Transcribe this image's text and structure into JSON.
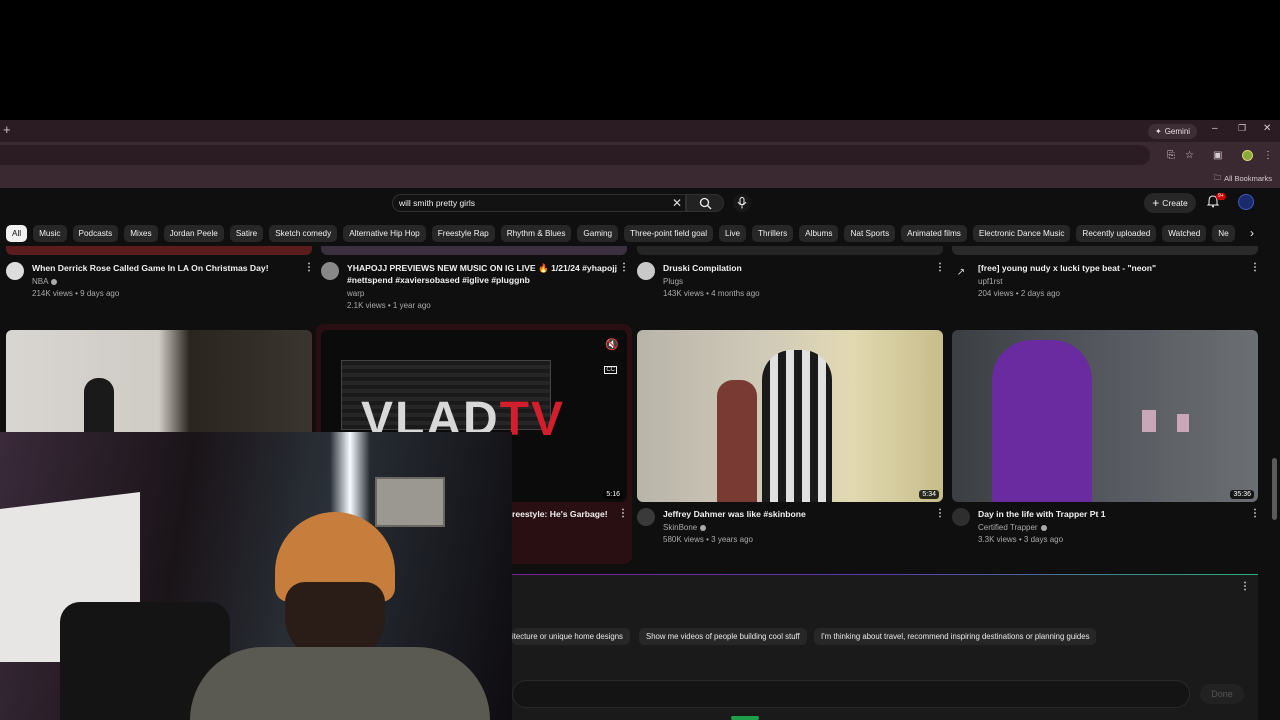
{
  "browser": {
    "new_tab_glyph": "+",
    "gemini_label": "Gemini",
    "bookmarks_label": "All Bookmarks"
  },
  "youtube": {
    "search": {
      "query": "will smith pretty girls"
    },
    "create_label": "Create",
    "notification_badge": "9+",
    "chips": [
      "All",
      "Music",
      "Podcasts",
      "Mixes",
      "Jordan Peele",
      "Satire",
      "Sketch comedy",
      "Alternative Hip Hop",
      "Freestyle Rap",
      "Rhythm & Blues",
      "Gaming",
      "Three-point field goal",
      "Live",
      "Thrillers",
      "Albums",
      "Nat Sports",
      "Animated films",
      "Electronic Dance Music",
      "Recently uploaded",
      "Watched",
      "Ne"
    ],
    "row1": [
      {
        "title": "When Derrick Rose Called Game In LA On Christmas Day!",
        "channel": "NBA",
        "meta": "214K views • 9 days ago"
      },
      {
        "title": "YHAPOJJ PREVIEWS NEW MUSIC ON IG LIVE 🔥 1/21/24 #yhapojj #nettspend #xaviersobased #iglive #pluggnb",
        "channel": "warp",
        "meta": "2.1K views • 1 year ago"
      },
      {
        "title": "Druski Compilation",
        "channel": "Plugs",
        "meta": "143K views • 4 months ago"
      },
      {
        "title": "[free] young nudy x lucki type beat - \"neon\"",
        "channel": "upf1rst",
        "meta": "204 views • 2 days ago"
      }
    ],
    "row2": [
      {
        "title": "",
        "duration": ""
      },
      {
        "title": "reestyle: He's Garbage!",
        "duration": "5:16",
        "overlay_text": "VLADTV"
      },
      {
        "title": "Jeffrey Dahmer was like #skinbone",
        "channel": "SkinBone",
        "meta": "580K views • 3 years ago",
        "duration": "5:34"
      },
      {
        "title": "Day in the life with Trapper Pt 1",
        "channel": "Certified Trapper",
        "meta": "3.3K views • 3 days ago",
        "duration": "35:36"
      }
    ],
    "gemini_prompts": [
      "itecture or unique home designs",
      "Show me videos of people building cool stuff",
      "I'm thinking about travel, recommend inspiring destinations or planning guides"
    ],
    "done_label": "Done"
  },
  "colors": {
    "accent_red": "#cc0000",
    "chip_bg": "#272727",
    "page_bg": "#0f0f0f"
  }
}
